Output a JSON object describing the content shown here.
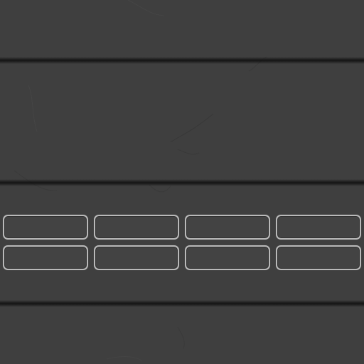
{
  "panel": {
    "slots": [
      {
        "id": "slot-1",
        "label": ""
      },
      {
        "id": "slot-2",
        "label": ""
      },
      {
        "id": "slot-3",
        "label": ""
      },
      {
        "id": "slot-4",
        "label": ""
      },
      {
        "id": "slot-5",
        "label": ""
      },
      {
        "id": "slot-6",
        "label": ""
      },
      {
        "id": "slot-7",
        "label": ""
      },
      {
        "id": "slot-8",
        "label": ""
      }
    ]
  },
  "colors": {
    "background": "#3f3f3f",
    "groove": "#1a1a1a",
    "slot_border": "#b9b9b9"
  }
}
